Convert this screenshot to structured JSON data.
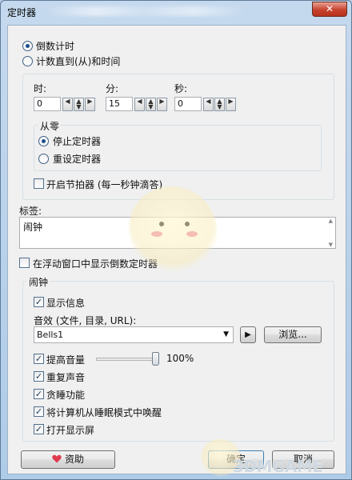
{
  "window": {
    "title": "定时器",
    "close_label": "✕"
  },
  "mode": {
    "countdown_label": "倒数计时",
    "countup_label": "计数直到(从)和时间",
    "selected": "countdown"
  },
  "time": {
    "hour_label": "时:",
    "minute_label": "分:",
    "second_label": "秒:",
    "hour_value": "0",
    "minute_value": "15",
    "second_value": "0"
  },
  "from_zero": {
    "group_label": "从零",
    "stop_timer_label": "停止定时器",
    "reset_timer_label": "重设定时器",
    "selected": "stop"
  },
  "metronome": {
    "label": "开启节拍器 (每一秒钟滴答)",
    "checked": false
  },
  "tag": {
    "label": "标签:",
    "value": "闹钟"
  },
  "floating": {
    "label": "在浮动窗口中显示倒数定时器",
    "checked": false
  },
  "alarm": {
    "group_label": "闹钟",
    "show_info_label": "显示信息",
    "show_info_checked": true,
    "sound_label": "音效 (文件, 目录, URL):",
    "sound_value": "Bells1",
    "play_label": "▶",
    "browse_label": "浏览...",
    "raise_volume_label": "提高音量",
    "raise_volume_checked": true,
    "volume_percent": "100%",
    "volume_fraction": 1.0,
    "repeat_sound_label": "重复声音",
    "repeat_sound_checked": true,
    "snooze_label": "贪睡功能",
    "snooze_checked": true,
    "wake_label": "将计算机从睡眠模式中唤醒",
    "wake_checked": true,
    "monitor_label": "打开显示屏",
    "monitor_checked": true
  },
  "buttons": {
    "donate_label": "资助",
    "ok_label": "确定",
    "cancel_label": "取消"
  },
  "watermark": "3DMGAME"
}
